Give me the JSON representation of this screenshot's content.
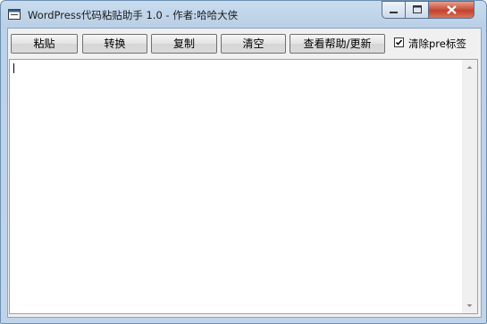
{
  "window": {
    "title": "WordPress代码粘贴助手 1.0 - 作者:哈哈大侠"
  },
  "toolbar": {
    "paste_label": "粘贴",
    "convert_label": "转换",
    "copy_label": "复制",
    "clear_label": "清空",
    "help_label": "查看帮助/更新"
  },
  "option": {
    "label": "清除pre标签",
    "checked": true
  },
  "editor": {
    "value": ""
  },
  "icons": {
    "app": "app-window-icon",
    "minimize": "minimize-icon",
    "maximize": "maximize-icon",
    "close": "close-icon",
    "scroll_up": "scroll-up-arrow-icon",
    "scroll_down": "scroll-down-arrow-icon",
    "check": "checkmark-icon"
  },
  "colors": {
    "close_button": "#c4432c",
    "frame": "#bcd2ea"
  }
}
